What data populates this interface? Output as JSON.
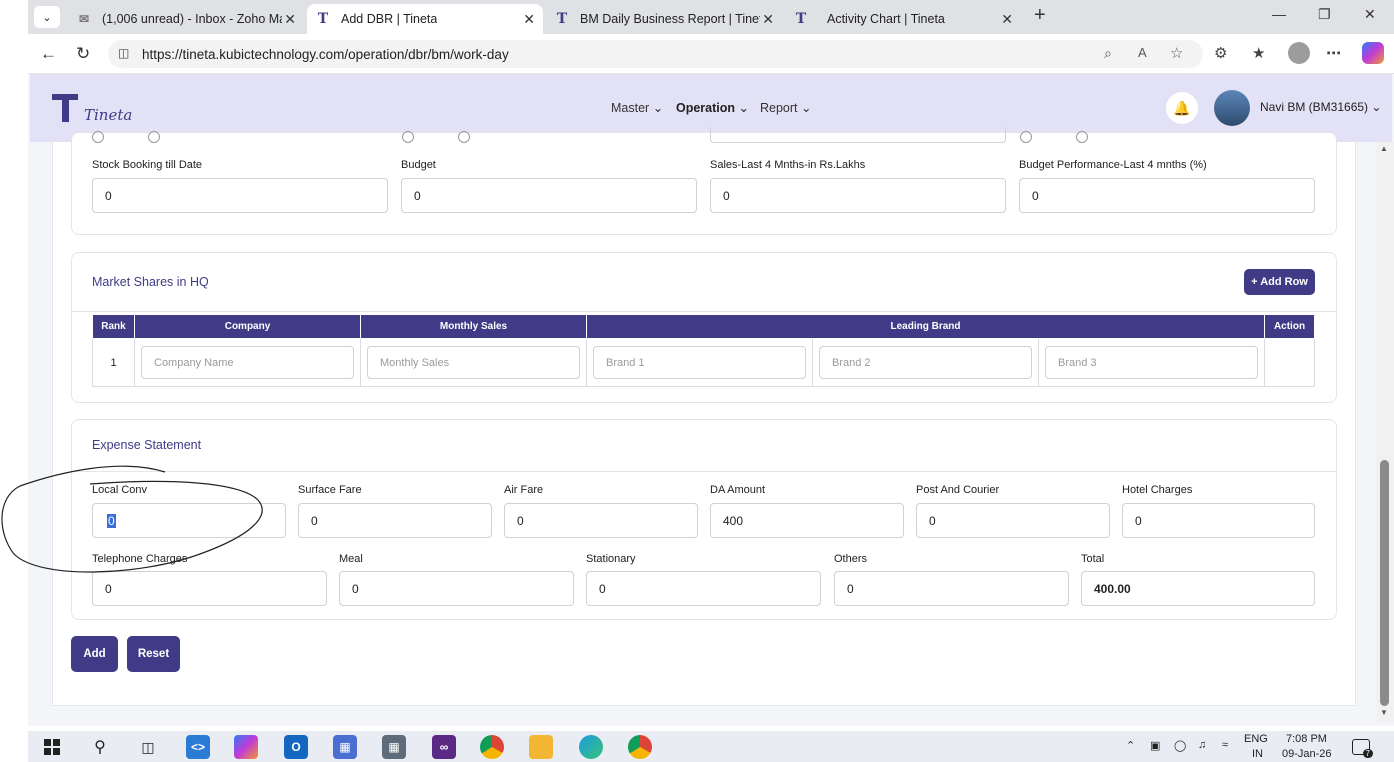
{
  "browser": {
    "tabs": [
      {
        "label": "(1,006 unread) - Inbox - Zoho Ma",
        "active": false
      },
      {
        "label": "Add DBR | Tineta",
        "active": true
      },
      {
        "label": "BM Daily Business Report | Tineta",
        "active": false
      },
      {
        "label": "Activity Chart | Tineta",
        "active": false
      }
    ],
    "url": "https://tineta.kubictechnology.com/operation/dbr/bm/work-day"
  },
  "app": {
    "brand": "Tineta",
    "nav": [
      "Master",
      "Operation",
      "Report"
    ],
    "active_nav": "Operation",
    "user": "Navi BM (BM31665)"
  },
  "stock_section": {
    "fields": [
      {
        "label": "Stock Booking till Date",
        "value": "0"
      },
      {
        "label": "Budget",
        "value": "0"
      },
      {
        "label": "Sales-Last 4 Mnths-in Rs.Lakhs",
        "value": "0"
      },
      {
        "label": "Budget Performance-Last 4 mnths (%)",
        "value": "0"
      }
    ]
  },
  "market_shares": {
    "title": "Market Shares in HQ",
    "add_row_label": "+ Add Row",
    "headers": [
      "Rank",
      "Company",
      "Monthly Sales",
      "Leading Brand",
      "Action"
    ],
    "rows": [
      {
        "rank": "1",
        "company_placeholder": "Company Name",
        "sales_placeholder": "Monthly Sales",
        "brand1_placeholder": "Brand 1",
        "brand2_placeholder": "Brand 2",
        "brand3_placeholder": "Brand 3"
      }
    ]
  },
  "expense": {
    "title": "Expense Statement",
    "row1": [
      {
        "label": "Local Conv",
        "value": "0"
      },
      {
        "label": "Surface Fare",
        "value": "0"
      },
      {
        "label": "Air Fare",
        "value": "0"
      },
      {
        "label": "DA Amount",
        "value": "400"
      },
      {
        "label": "Post And Courier",
        "value": "0"
      },
      {
        "label": "Hotel Charges",
        "value": "0"
      }
    ],
    "row2": [
      {
        "label": "Telephone Charges",
        "value": "0"
      },
      {
        "label": "Meal",
        "value": "0"
      },
      {
        "label": "Stationary",
        "value": "0"
      },
      {
        "label": "Others",
        "value": "0"
      },
      {
        "label": "Total",
        "value": "400.00"
      }
    ]
  },
  "actions": {
    "add": "Add",
    "reset": "Reset"
  },
  "taskbar": {
    "lang": "ENG",
    "region": "IN",
    "time": "7:08 PM",
    "date": "09-Jan-26",
    "notifications": "7"
  },
  "colors": {
    "brand": "#3f3b87",
    "header_bg": "#e3e1f5"
  }
}
